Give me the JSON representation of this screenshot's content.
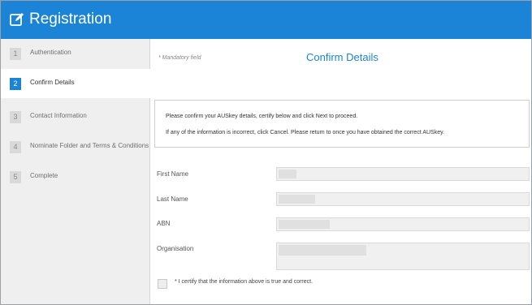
{
  "header": {
    "title": "Registration",
    "icon": "edit-icon",
    "color": "#1c84d6"
  },
  "sidebar": {
    "items": [
      {
        "number": "1",
        "label": "Authentication",
        "active": false
      },
      {
        "number": "2",
        "label": "Confirm Details",
        "active": true
      },
      {
        "number": "3",
        "label": "Contact Information",
        "active": false
      },
      {
        "number": "4",
        "label": "Nominate Folder and Terms & Conditions",
        "active": false
      },
      {
        "number": "5",
        "label": "Complete",
        "active": false
      }
    ]
  },
  "main": {
    "mandatory_note": "* Mandatory field",
    "title": "Confirm Details",
    "info": {
      "line1": "Please confirm your AUSkey details, certify below and click Next to proceed.",
      "line2": "If any of the information is incorrect, click Cancel. Please return to once you have obtained the correct AUSkey."
    },
    "fields": {
      "first_name": {
        "label": "First Name",
        "value": ""
      },
      "last_name": {
        "label": "Last Name",
        "value": ""
      },
      "abn": {
        "label": "ABN",
        "value": ""
      },
      "organisation": {
        "label": "Organisation",
        "value": ""
      }
    },
    "certify": {
      "label": "* I certify that the information above is true and correct.",
      "checked": false
    }
  }
}
